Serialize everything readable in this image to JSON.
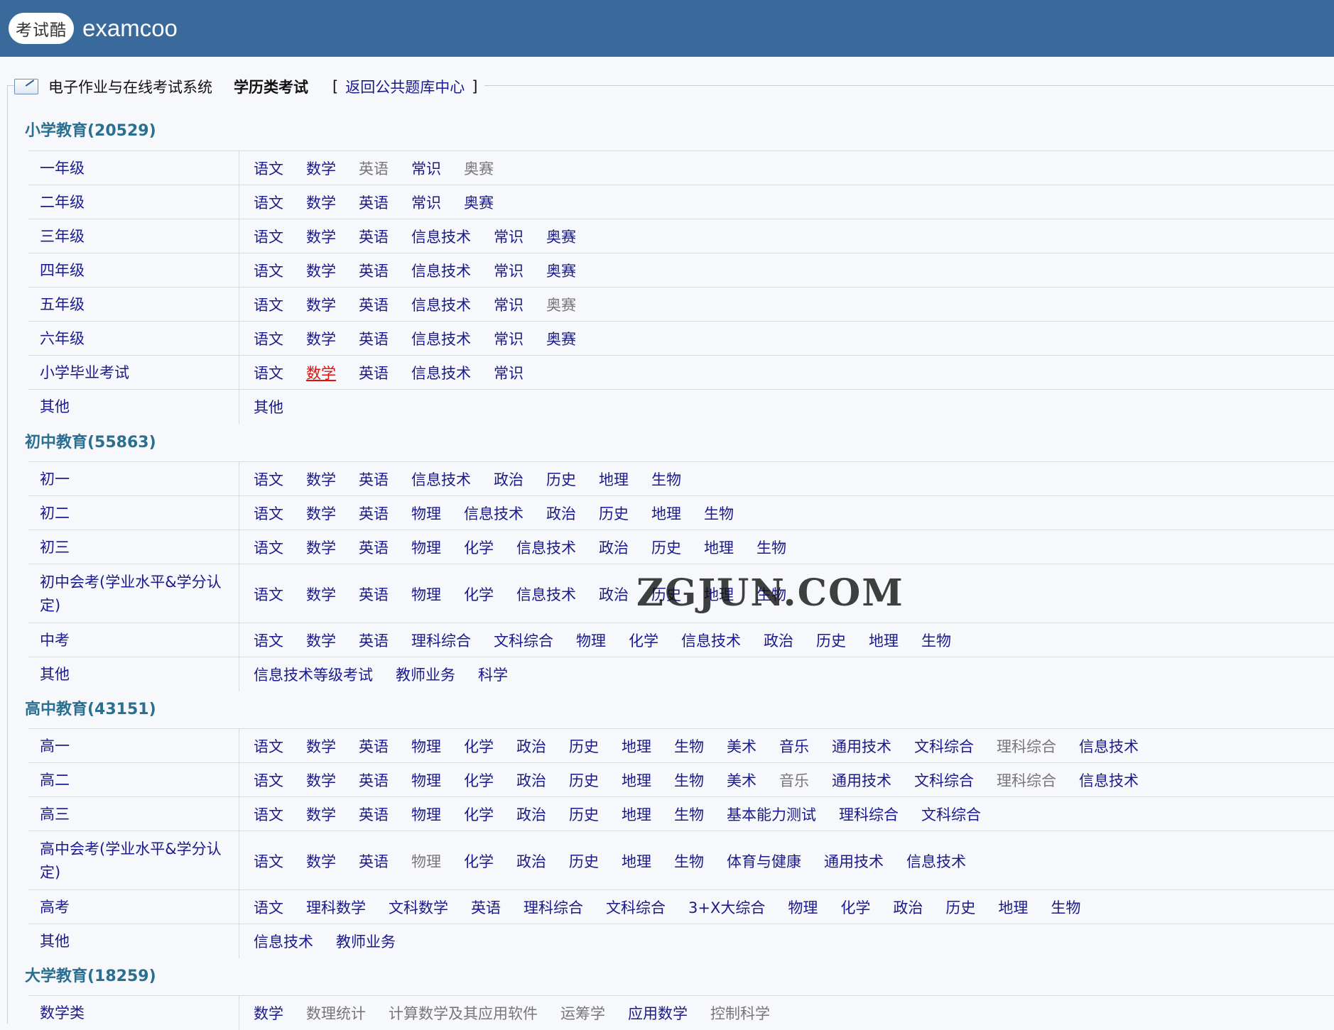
{
  "header": {
    "logo_text": "考试酷",
    "brand": "examcoo"
  },
  "nav": {
    "system": "电子作业与在线考试系统",
    "current": "学历类考试",
    "open_bracket": "[",
    "back_link": "返回公共题库中心",
    "close_bracket": "]"
  },
  "watermark": "ZGJUN.COM",
  "sections": [
    {
      "title": "小学教育(20529)",
      "rows": [
        {
          "label": "一年级",
          "items": [
            {
              "t": "语文",
              "s": "link"
            },
            {
              "t": "数学",
              "s": "link"
            },
            {
              "t": "英语",
              "s": "dim"
            },
            {
              "t": "常识",
              "s": "link"
            },
            {
              "t": "奥赛",
              "s": "dim"
            }
          ]
        },
        {
          "label": "二年级",
          "items": [
            {
              "t": "语文",
              "s": "link"
            },
            {
              "t": "数学",
              "s": "link"
            },
            {
              "t": "英语",
              "s": "link"
            },
            {
              "t": "常识",
              "s": "link"
            },
            {
              "t": "奥赛",
              "s": "link"
            }
          ]
        },
        {
          "label": "三年级",
          "items": [
            {
              "t": "语文",
              "s": "link"
            },
            {
              "t": "数学",
              "s": "link"
            },
            {
              "t": "英语",
              "s": "link"
            },
            {
              "t": "信息技术",
              "s": "link"
            },
            {
              "t": "常识",
              "s": "link"
            },
            {
              "t": "奥赛",
              "s": "link"
            }
          ]
        },
        {
          "label": "四年级",
          "items": [
            {
              "t": "语文",
              "s": "link"
            },
            {
              "t": "数学",
              "s": "link"
            },
            {
              "t": "英语",
              "s": "link"
            },
            {
              "t": "信息技术",
              "s": "link"
            },
            {
              "t": "常识",
              "s": "link"
            },
            {
              "t": "奥赛",
              "s": "link"
            }
          ]
        },
        {
          "label": "五年级",
          "items": [
            {
              "t": "语文",
              "s": "link"
            },
            {
              "t": "数学",
              "s": "link"
            },
            {
              "t": "英语",
              "s": "link"
            },
            {
              "t": "信息技术",
              "s": "link"
            },
            {
              "t": "常识",
              "s": "link"
            },
            {
              "t": "奥赛",
              "s": "dim"
            }
          ]
        },
        {
          "label": "六年级",
          "items": [
            {
              "t": "语文",
              "s": "link"
            },
            {
              "t": "数学",
              "s": "link"
            },
            {
              "t": "英语",
              "s": "link"
            },
            {
              "t": "信息技术",
              "s": "link"
            },
            {
              "t": "常识",
              "s": "link"
            },
            {
              "t": "奥赛",
              "s": "link"
            }
          ]
        },
        {
          "label": "小学毕业考试",
          "items": [
            {
              "t": "语文",
              "s": "link"
            },
            {
              "t": "数学",
              "s": "hot"
            },
            {
              "t": "英语",
              "s": "link"
            },
            {
              "t": "信息技术",
              "s": "link"
            },
            {
              "t": "常识",
              "s": "link"
            }
          ]
        },
        {
          "label": "其他",
          "items": [
            {
              "t": "其他",
              "s": "link"
            }
          ]
        }
      ]
    },
    {
      "title": "初中教育(55863)",
      "rows": [
        {
          "label": "初一",
          "items": [
            {
              "t": "语文",
              "s": "link"
            },
            {
              "t": "数学",
              "s": "link"
            },
            {
              "t": "英语",
              "s": "link"
            },
            {
              "t": "信息技术",
              "s": "link"
            },
            {
              "t": "政治",
              "s": "link"
            },
            {
              "t": "历史",
              "s": "link"
            },
            {
              "t": "地理",
              "s": "link"
            },
            {
              "t": "生物",
              "s": "link"
            }
          ]
        },
        {
          "label": "初二",
          "items": [
            {
              "t": "语文",
              "s": "link"
            },
            {
              "t": "数学",
              "s": "link"
            },
            {
              "t": "英语",
              "s": "link"
            },
            {
              "t": "物理",
              "s": "link"
            },
            {
              "t": "信息技术",
              "s": "link"
            },
            {
              "t": "政治",
              "s": "link"
            },
            {
              "t": "历史",
              "s": "link"
            },
            {
              "t": "地理",
              "s": "link"
            },
            {
              "t": "生物",
              "s": "link"
            }
          ]
        },
        {
          "label": "初三",
          "items": [
            {
              "t": "语文",
              "s": "link"
            },
            {
              "t": "数学",
              "s": "link"
            },
            {
              "t": "英语",
              "s": "link"
            },
            {
              "t": "物理",
              "s": "link"
            },
            {
              "t": "化学",
              "s": "link"
            },
            {
              "t": "信息技术",
              "s": "link"
            },
            {
              "t": "政治",
              "s": "link"
            },
            {
              "t": "历史",
              "s": "link"
            },
            {
              "t": "地理",
              "s": "link"
            },
            {
              "t": "生物",
              "s": "link"
            }
          ]
        },
        {
          "label": "初中会考(学业水平&学分认定)",
          "items": [
            {
              "t": "语文",
              "s": "link"
            },
            {
              "t": "数学",
              "s": "link"
            },
            {
              "t": "英语",
              "s": "link"
            },
            {
              "t": "物理",
              "s": "link"
            },
            {
              "t": "化学",
              "s": "link"
            },
            {
              "t": "信息技术",
              "s": "link"
            },
            {
              "t": "政治",
              "s": "link"
            },
            {
              "t": "历史",
              "s": "link"
            },
            {
              "t": "地理",
              "s": "link"
            },
            {
              "t": "生物",
              "s": "link"
            }
          ]
        },
        {
          "label": "中考",
          "items": [
            {
              "t": "语文",
              "s": "link"
            },
            {
              "t": "数学",
              "s": "link"
            },
            {
              "t": "英语",
              "s": "link"
            },
            {
              "t": "理科综合",
              "s": "link"
            },
            {
              "t": "文科综合",
              "s": "link"
            },
            {
              "t": "物理",
              "s": "link"
            },
            {
              "t": "化学",
              "s": "link"
            },
            {
              "t": "信息技术",
              "s": "link"
            },
            {
              "t": "政治",
              "s": "link"
            },
            {
              "t": "历史",
              "s": "link"
            },
            {
              "t": "地理",
              "s": "link"
            },
            {
              "t": "生物",
              "s": "link"
            }
          ]
        },
        {
          "label": "其他",
          "items": [
            {
              "t": "信息技术等级考试",
              "s": "link"
            },
            {
              "t": "教师业务",
              "s": "link"
            },
            {
              "t": "科学",
              "s": "link"
            }
          ]
        }
      ]
    },
    {
      "title": "高中教育(43151)",
      "rows": [
        {
          "label": "高一",
          "items": [
            {
              "t": "语文",
              "s": "link"
            },
            {
              "t": "数学",
              "s": "link"
            },
            {
              "t": "英语",
              "s": "link"
            },
            {
              "t": "物理",
              "s": "link"
            },
            {
              "t": "化学",
              "s": "link"
            },
            {
              "t": "政治",
              "s": "link"
            },
            {
              "t": "历史",
              "s": "link"
            },
            {
              "t": "地理",
              "s": "link"
            },
            {
              "t": "生物",
              "s": "link"
            },
            {
              "t": "美术",
              "s": "link"
            },
            {
              "t": "音乐",
              "s": "link"
            },
            {
              "t": "通用技术",
              "s": "link"
            },
            {
              "t": "文科综合",
              "s": "link"
            },
            {
              "t": "理科综合",
              "s": "dim"
            },
            {
              "t": "信息技术",
              "s": "link"
            }
          ]
        },
        {
          "label": "高二",
          "items": [
            {
              "t": "语文",
              "s": "link"
            },
            {
              "t": "数学",
              "s": "link"
            },
            {
              "t": "英语",
              "s": "link"
            },
            {
              "t": "物理",
              "s": "link"
            },
            {
              "t": "化学",
              "s": "link"
            },
            {
              "t": "政治",
              "s": "link"
            },
            {
              "t": "历史",
              "s": "link"
            },
            {
              "t": "地理",
              "s": "link"
            },
            {
              "t": "生物",
              "s": "link"
            },
            {
              "t": "美术",
              "s": "link"
            },
            {
              "t": "音乐",
              "s": "dim"
            },
            {
              "t": "通用技术",
              "s": "link"
            },
            {
              "t": "文科综合",
              "s": "link"
            },
            {
              "t": "理科综合",
              "s": "dim"
            },
            {
              "t": "信息技术",
              "s": "link"
            }
          ]
        },
        {
          "label": "高三",
          "items": [
            {
              "t": "语文",
              "s": "link"
            },
            {
              "t": "数学",
              "s": "link"
            },
            {
              "t": "英语",
              "s": "link"
            },
            {
              "t": "物理",
              "s": "link"
            },
            {
              "t": "化学",
              "s": "link"
            },
            {
              "t": "政治",
              "s": "link"
            },
            {
              "t": "历史",
              "s": "link"
            },
            {
              "t": "地理",
              "s": "link"
            },
            {
              "t": "生物",
              "s": "link"
            },
            {
              "t": "基本能力测试",
              "s": "link"
            },
            {
              "t": "理科综合",
              "s": "link"
            },
            {
              "t": "文科综合",
              "s": "link"
            }
          ]
        },
        {
          "label": "高中会考(学业水平&学分认定)",
          "items": [
            {
              "t": "语文",
              "s": "link"
            },
            {
              "t": "数学",
              "s": "link"
            },
            {
              "t": "英语",
              "s": "link"
            },
            {
              "t": "物理",
              "s": "dim"
            },
            {
              "t": "化学",
              "s": "link"
            },
            {
              "t": "政治",
              "s": "link"
            },
            {
              "t": "历史",
              "s": "link"
            },
            {
              "t": "地理",
              "s": "link"
            },
            {
              "t": "生物",
              "s": "link"
            },
            {
              "t": "体育与健康",
              "s": "link"
            },
            {
              "t": "通用技术",
              "s": "link"
            },
            {
              "t": "信息技术",
              "s": "link"
            }
          ]
        },
        {
          "label": "高考",
          "items": [
            {
              "t": "语文",
              "s": "link"
            },
            {
              "t": "理科数学",
              "s": "link"
            },
            {
              "t": "文科数学",
              "s": "link"
            },
            {
              "t": "英语",
              "s": "link"
            },
            {
              "t": "理科综合",
              "s": "link"
            },
            {
              "t": "文科综合",
              "s": "link"
            },
            {
              "t": "3+X大综合",
              "s": "link"
            },
            {
              "t": "物理",
              "s": "link"
            },
            {
              "t": "化学",
              "s": "link"
            },
            {
              "t": "政治",
              "s": "link"
            },
            {
              "t": "历史",
              "s": "link"
            },
            {
              "t": "地理",
              "s": "link"
            },
            {
              "t": "生物",
              "s": "link"
            }
          ]
        },
        {
          "label": "其他",
          "items": [
            {
              "t": "信息技术",
              "s": "link"
            },
            {
              "t": "教师业务",
              "s": "link"
            }
          ]
        }
      ]
    },
    {
      "title": "大学教育(18259)",
      "rows": [
        {
          "label": "数学类",
          "items": [
            {
              "t": "数学",
              "s": "link"
            },
            {
              "t": "数理统计",
              "s": "dim"
            },
            {
              "t": "计算数学及其应用软件",
              "s": "dim"
            },
            {
              "t": "运筹学",
              "s": "dim"
            },
            {
              "t": "应用数学",
              "s": "link"
            },
            {
              "t": "控制科学",
              "s": "dim"
            }
          ]
        }
      ]
    }
  ]
}
